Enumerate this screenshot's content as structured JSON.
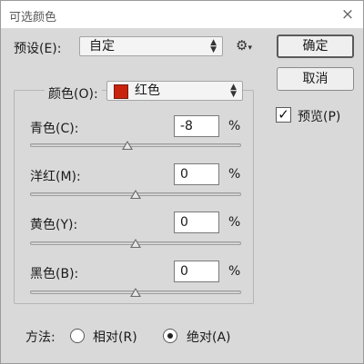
{
  "window": {
    "title": "可选颜色",
    "close_label": "×"
  },
  "preset": {
    "label": "预设(E):",
    "value": "自定"
  },
  "buttons": {
    "ok": "确定",
    "cancel": "取消"
  },
  "preview": {
    "label": "预览(P)",
    "checked": true,
    "check_glyph": "✓"
  },
  "colors": {
    "label": "颜色(O):",
    "value": "红色",
    "swatch": "#c8230c"
  },
  "sliders": [
    {
      "label": "青色(C):",
      "value": "-8",
      "unit": "%",
      "level": -8
    },
    {
      "label": "洋红(M):",
      "value": "0",
      "unit": "%",
      "level": 0
    },
    {
      "label": "黄色(Y):",
      "value": "0",
      "unit": "%",
      "level": 0
    },
    {
      "label": "黑色(B):",
      "value": "0",
      "unit": "%",
      "level": 0
    }
  ],
  "method": {
    "label": "方法:",
    "options": [
      {
        "label": "相对(R)",
        "selected": false
      },
      {
        "label": "绝对(A)",
        "selected": true
      }
    ]
  },
  "icons": {
    "gear": "⚙",
    "dropdown_arrows": "▲\n▼"
  }
}
